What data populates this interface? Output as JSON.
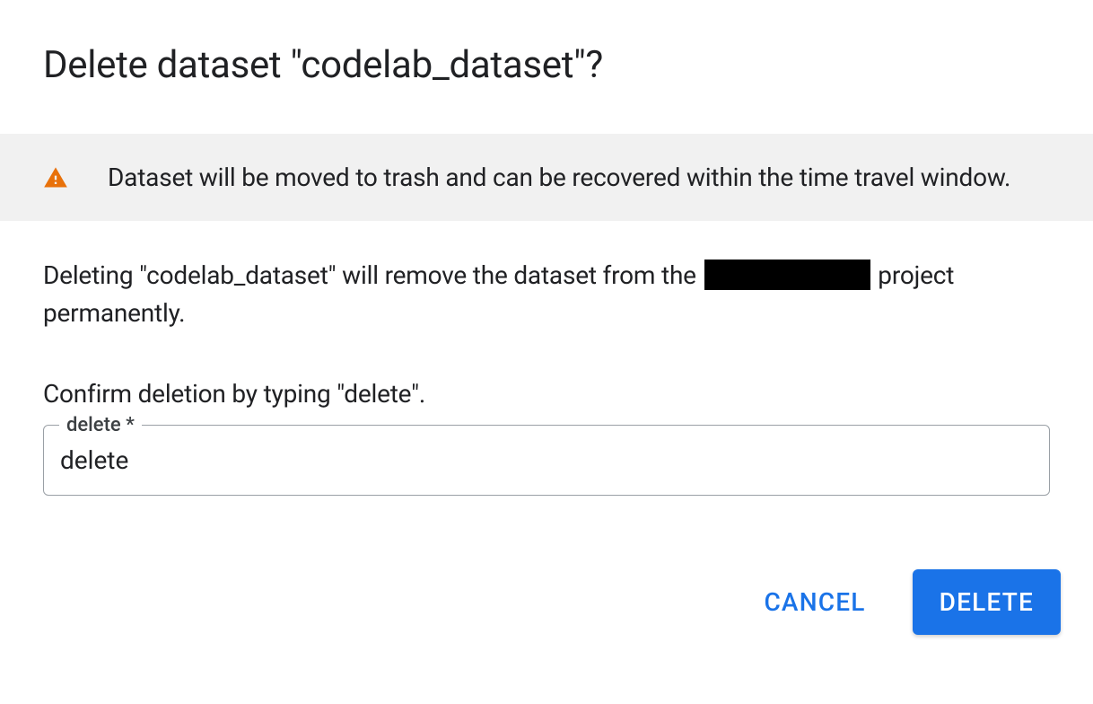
{
  "dialog": {
    "title": "Delete dataset \"codelab_dataset\"?",
    "banner_text": "Dataset will be moved to trash and can be recovered within the time travel window.",
    "description_pre": "Deleting \"codelab_dataset\" will remove the dataset from the ",
    "description_post": " project permanently.",
    "confirm_instruction": "Confirm deletion by typing \"delete\".",
    "input_label": "delete *",
    "input_value": "delete",
    "cancel_label": "CANCEL",
    "delete_label": "DELETE"
  }
}
